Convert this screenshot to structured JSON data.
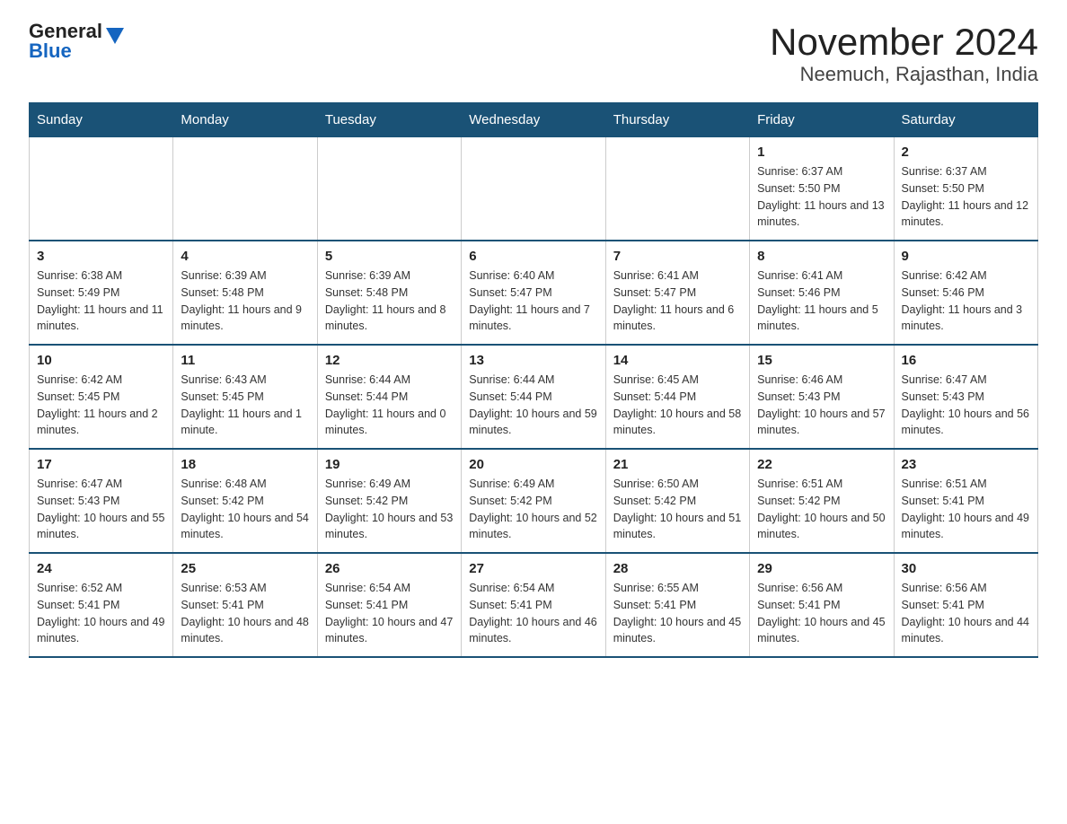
{
  "header": {
    "logo_general": "General",
    "logo_blue": "Blue",
    "title": "November 2024",
    "subtitle": "Neemuch, Rajasthan, India"
  },
  "weekdays": [
    "Sunday",
    "Monday",
    "Tuesday",
    "Wednesday",
    "Thursday",
    "Friday",
    "Saturday"
  ],
  "weeks": [
    [
      {
        "day": "",
        "info": ""
      },
      {
        "day": "",
        "info": ""
      },
      {
        "day": "",
        "info": ""
      },
      {
        "day": "",
        "info": ""
      },
      {
        "day": "",
        "info": ""
      },
      {
        "day": "1",
        "info": "Sunrise: 6:37 AM\nSunset: 5:50 PM\nDaylight: 11 hours and 13 minutes."
      },
      {
        "day": "2",
        "info": "Sunrise: 6:37 AM\nSunset: 5:50 PM\nDaylight: 11 hours and 12 minutes."
      }
    ],
    [
      {
        "day": "3",
        "info": "Sunrise: 6:38 AM\nSunset: 5:49 PM\nDaylight: 11 hours and 11 minutes."
      },
      {
        "day": "4",
        "info": "Sunrise: 6:39 AM\nSunset: 5:48 PM\nDaylight: 11 hours and 9 minutes."
      },
      {
        "day": "5",
        "info": "Sunrise: 6:39 AM\nSunset: 5:48 PM\nDaylight: 11 hours and 8 minutes."
      },
      {
        "day": "6",
        "info": "Sunrise: 6:40 AM\nSunset: 5:47 PM\nDaylight: 11 hours and 7 minutes."
      },
      {
        "day": "7",
        "info": "Sunrise: 6:41 AM\nSunset: 5:47 PM\nDaylight: 11 hours and 6 minutes."
      },
      {
        "day": "8",
        "info": "Sunrise: 6:41 AM\nSunset: 5:46 PM\nDaylight: 11 hours and 5 minutes."
      },
      {
        "day": "9",
        "info": "Sunrise: 6:42 AM\nSunset: 5:46 PM\nDaylight: 11 hours and 3 minutes."
      }
    ],
    [
      {
        "day": "10",
        "info": "Sunrise: 6:42 AM\nSunset: 5:45 PM\nDaylight: 11 hours and 2 minutes."
      },
      {
        "day": "11",
        "info": "Sunrise: 6:43 AM\nSunset: 5:45 PM\nDaylight: 11 hours and 1 minute."
      },
      {
        "day": "12",
        "info": "Sunrise: 6:44 AM\nSunset: 5:44 PM\nDaylight: 11 hours and 0 minutes."
      },
      {
        "day": "13",
        "info": "Sunrise: 6:44 AM\nSunset: 5:44 PM\nDaylight: 10 hours and 59 minutes."
      },
      {
        "day": "14",
        "info": "Sunrise: 6:45 AM\nSunset: 5:44 PM\nDaylight: 10 hours and 58 minutes."
      },
      {
        "day": "15",
        "info": "Sunrise: 6:46 AM\nSunset: 5:43 PM\nDaylight: 10 hours and 57 minutes."
      },
      {
        "day": "16",
        "info": "Sunrise: 6:47 AM\nSunset: 5:43 PM\nDaylight: 10 hours and 56 minutes."
      }
    ],
    [
      {
        "day": "17",
        "info": "Sunrise: 6:47 AM\nSunset: 5:43 PM\nDaylight: 10 hours and 55 minutes."
      },
      {
        "day": "18",
        "info": "Sunrise: 6:48 AM\nSunset: 5:42 PM\nDaylight: 10 hours and 54 minutes."
      },
      {
        "day": "19",
        "info": "Sunrise: 6:49 AM\nSunset: 5:42 PM\nDaylight: 10 hours and 53 minutes."
      },
      {
        "day": "20",
        "info": "Sunrise: 6:49 AM\nSunset: 5:42 PM\nDaylight: 10 hours and 52 minutes."
      },
      {
        "day": "21",
        "info": "Sunrise: 6:50 AM\nSunset: 5:42 PM\nDaylight: 10 hours and 51 minutes."
      },
      {
        "day": "22",
        "info": "Sunrise: 6:51 AM\nSunset: 5:42 PM\nDaylight: 10 hours and 50 minutes."
      },
      {
        "day": "23",
        "info": "Sunrise: 6:51 AM\nSunset: 5:41 PM\nDaylight: 10 hours and 49 minutes."
      }
    ],
    [
      {
        "day": "24",
        "info": "Sunrise: 6:52 AM\nSunset: 5:41 PM\nDaylight: 10 hours and 49 minutes."
      },
      {
        "day": "25",
        "info": "Sunrise: 6:53 AM\nSunset: 5:41 PM\nDaylight: 10 hours and 48 minutes."
      },
      {
        "day": "26",
        "info": "Sunrise: 6:54 AM\nSunset: 5:41 PM\nDaylight: 10 hours and 47 minutes."
      },
      {
        "day": "27",
        "info": "Sunrise: 6:54 AM\nSunset: 5:41 PM\nDaylight: 10 hours and 46 minutes."
      },
      {
        "day": "28",
        "info": "Sunrise: 6:55 AM\nSunset: 5:41 PM\nDaylight: 10 hours and 45 minutes."
      },
      {
        "day": "29",
        "info": "Sunrise: 6:56 AM\nSunset: 5:41 PM\nDaylight: 10 hours and 45 minutes."
      },
      {
        "day": "30",
        "info": "Sunrise: 6:56 AM\nSunset: 5:41 PM\nDaylight: 10 hours and 44 minutes."
      }
    ]
  ]
}
